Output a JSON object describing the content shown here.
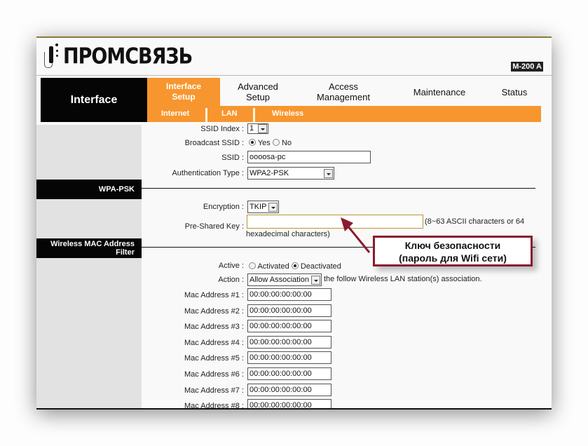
{
  "brand": {
    "logo_text": "ПРОМСВЯЗЬ",
    "model": "M-200 A"
  },
  "nav": {
    "section_label": "Interface",
    "active_tab": "Interface Setup",
    "tabs": [
      {
        "label": "Advanced Setup"
      },
      {
        "label": "Access Management"
      },
      {
        "label": "Maintenance"
      },
      {
        "label": "Status"
      }
    ],
    "sub_items": [
      "Internet",
      "LAN",
      "Wireless"
    ]
  },
  "sections": {
    "wpa_psk": "WPA-PSK",
    "mac_filter": "Wireless MAC Address Filter"
  },
  "wireless": {
    "ssid_index_label": "SSID Index :",
    "ssid_index_value": "1",
    "broadcast_label": "Broadcast SSID :",
    "broadcast_yes": "Yes",
    "broadcast_no": "No",
    "broadcast_selected": "Yes",
    "ssid_label": "SSID :",
    "ssid_value": "oooosa-pc",
    "auth_label": "Authentication Type :",
    "auth_value": "WPA2-PSK"
  },
  "wpa": {
    "encryption_label": "Encryption :",
    "encryption_value": "TKIP",
    "psk_label": "Pre-Shared Key :",
    "psk_value": "",
    "psk_hint_1": "(8~63 ASCII characters or 64",
    "psk_hint_2": "hexadecimal characters)"
  },
  "mac_filter": {
    "active_label": "Active :",
    "activated": "Activated",
    "deactivated": "Deactivated",
    "active_selected": "Deactivated",
    "action_label": "Action :",
    "action_value": "Allow Association",
    "action_suffix": "the follow Wireless LAN station(s) association.",
    "addresses": [
      {
        "label": "Mac Address #1 :",
        "value": "00:00:00:00:00:00"
      },
      {
        "label": "Mac Address #2 :",
        "value": "00:00:00:00:00:00"
      },
      {
        "label": "Mac Address #3 :",
        "value": "00:00:00:00:00:00"
      },
      {
        "label": "Mac Address #4 :",
        "value": "00:00:00:00:00:00"
      },
      {
        "label": "Mac Address #5 :",
        "value": "00:00:00:00:00:00"
      },
      {
        "label": "Mac Address #6 :",
        "value": "00:00:00:00:00:00"
      },
      {
        "label": "Mac Address #7 :",
        "value": "00:00:00:00:00:00"
      },
      {
        "label": "Mac Address #8 :",
        "value": "00:00:00:00:00:00"
      }
    ]
  },
  "annotation": {
    "line1": "Ключ безопасности",
    "line2": "(пароль для Wifi сети)",
    "color": "#8b1a2e"
  }
}
